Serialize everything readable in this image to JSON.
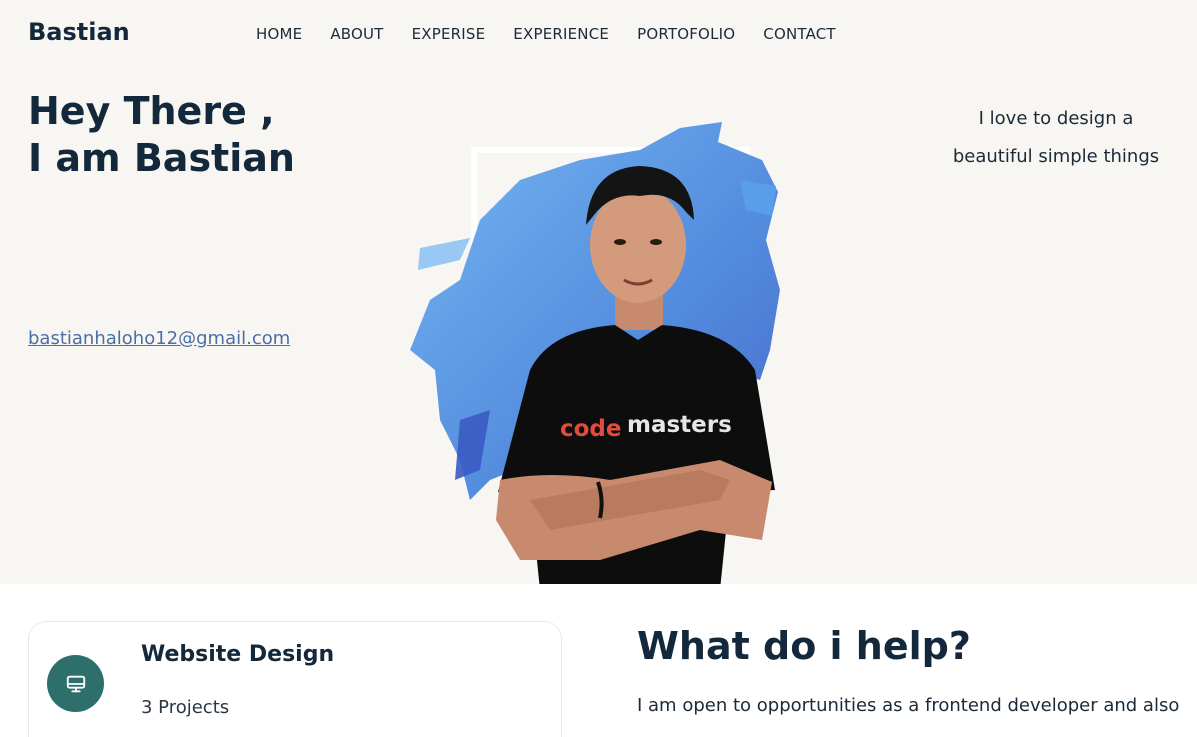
{
  "header": {
    "logo": "Bastian",
    "nav": [
      "HOME",
      "ABOUT",
      "EXPERISE",
      "EXPERIENCE",
      "PORTOFOLIO",
      "CONTACT"
    ]
  },
  "hero": {
    "title_line1": "Hey There ,",
    "title_line2": "I am Bastian",
    "email": "bastianhaloho12@gmail.com",
    "tagline_line1": "I love to design a",
    "tagline_line2": "beautiful simple things",
    "shirt_text_red": "code",
    "shirt_text_white": "masters"
  },
  "services": {
    "card": {
      "icon": "monitor-icon",
      "title": "Website Design",
      "subtitle": "3 Projects"
    },
    "heading": "What do i help?",
    "text": "I am open to opportunities as a frontend developer and also"
  },
  "colors": {
    "hero_bg": "#f8f6f2",
    "text_dark": "#13283a",
    "email_link": "#4a6fa5",
    "icon_circle": "#2c6f6b",
    "brush_blue": "#4a8fe0"
  }
}
